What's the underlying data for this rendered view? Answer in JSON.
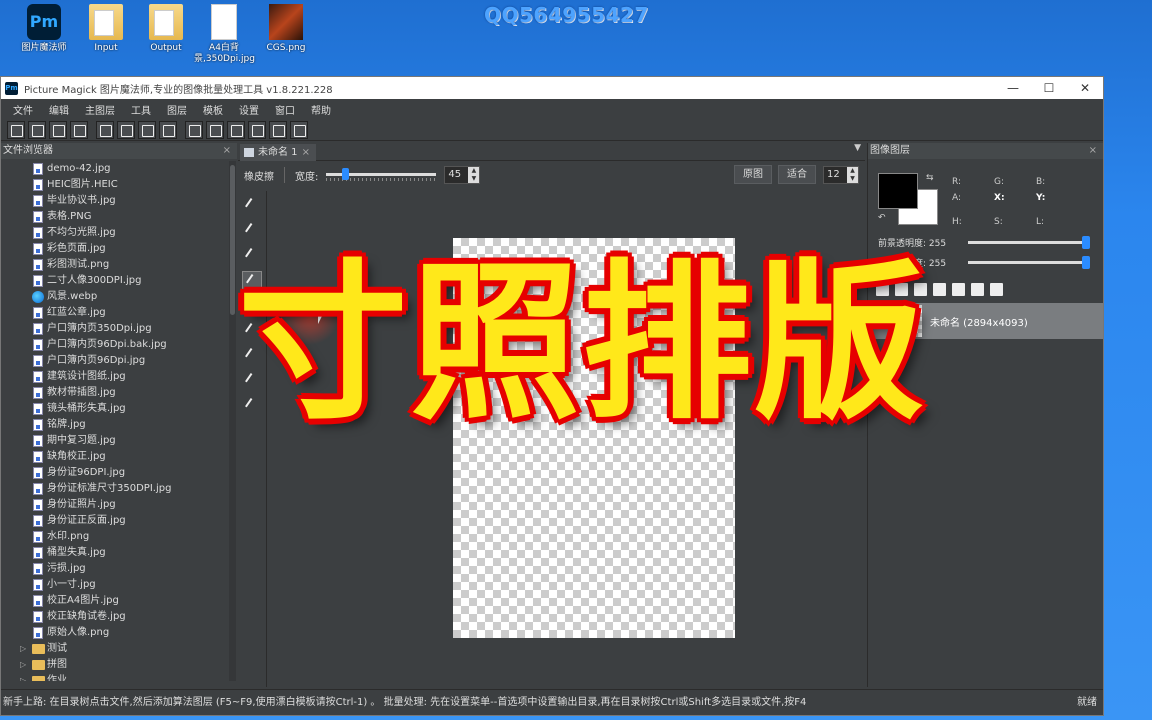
{
  "desktop": {
    "watermark": "QQ564955427",
    "icons": [
      {
        "label": "图片魔法师",
        "icon": "pm-app-icon",
        "glyph": "Pm"
      },
      {
        "label": "Input",
        "icon": "folder-icon"
      },
      {
        "label": "Output",
        "icon": "folder-icon"
      },
      {
        "label": "A4白背景,350Dpi.jpg",
        "icon": "image-file-icon"
      },
      {
        "label": "CGS.png",
        "icon": "image-file-icon"
      }
    ]
  },
  "window": {
    "app_icon": "Pm",
    "title": "Picture Magick 图片魔法师,专业的图像批量处理工具 v1.8.221.228",
    "controls": {
      "minimize": "—",
      "maximize": "☐",
      "close": "✕"
    }
  },
  "menu": [
    "文件",
    "编辑",
    "主图层",
    "工具",
    "图层",
    "模板",
    "设置",
    "窗口",
    "帮助"
  ],
  "file_browser": {
    "title": "文件浏览器",
    "close": "×",
    "files": [
      "demo-42.jpg",
      "HEIC图片.HEIC",
      "毕业协议书.jpg",
      "表格.PNG",
      "不均匀光照.jpg",
      "彩色页面.jpg",
      "彩图测试.png",
      "二寸人像300DPI.jpg",
      "风景.webp",
      "红蓝公章.jpg",
      "户口簿内页350Dpi.jpg",
      "户口簿内页96Dpi.bak.jpg",
      "户口簿内页96Dpi.jpg",
      "建筑设计图纸.jpg",
      "教材带插图.jpg",
      "镜头桶形失真.jpg",
      "铭牌.jpg",
      "期中复习题.jpg",
      "缺角校正.jpg",
      "身份证96DPI.jpg",
      "身份证标准尺寸350DPI.jpg",
      "身份证照片.jpg",
      "身份证正反面.jpg",
      "水印.png",
      "桶型失真.jpg",
      "污损.jpg",
      "小一寸.jpg",
      "校正A4图片.jpg",
      "校正缺角试卷.jpg",
      "原始人像.png"
    ],
    "folders": [
      "测试",
      "拼图",
      "作业"
    ]
  },
  "editor": {
    "tab_label": "未命名 1",
    "tab_close": "×",
    "tab_menu": "▼",
    "tool_name": "橡皮擦",
    "width_label": "宽度:",
    "width_value": "45",
    "width_fraction": 0.15,
    "original_button": "原图",
    "fit_button": "适合",
    "zoom_value": "12",
    "overlay_title": "寸照排版",
    "tools": [
      "add-brush-icon",
      "pencil-icon",
      "brush-icon",
      "eraser-icon",
      "eyedropper-icon",
      "select-icon",
      "crop-icon",
      "lasso-icon",
      "stamp-icon"
    ]
  },
  "layers_panel": {
    "title": "图像图层",
    "close": "×",
    "swap": "⇆",
    "reset": "↶",
    "labels": {
      "R": "R:",
      "G": "G:",
      "B": "B:",
      "A": "A:",
      "X": "X:",
      "Y": "Y:",
      "H": "H:",
      "S": "S:",
      "L": "L:"
    },
    "fg_opacity_label": "前景透明度:",
    "fg_opacity_value": "255",
    "bg_opacity_label": "背景透明度:",
    "bg_opacity_value": "255",
    "fg_opacity_fraction": 1.0,
    "bg_opacity_fraction": 1.0,
    "foreground_color": "#000000",
    "background_color": "#ffffff",
    "layer_name": "未命名 (2894x4093)"
  },
  "status": {
    "message": "新手上路: 在目录树点击文件,然后添加算法图层 (F5~F9,使用漂白模板请按Ctrl-1) 。 批量处理: 先在设置菜单--首选项中设置输出目录,再在目录树按Ctrl或Shift多选目录或文件,按F4",
    "state": "就绪"
  }
}
